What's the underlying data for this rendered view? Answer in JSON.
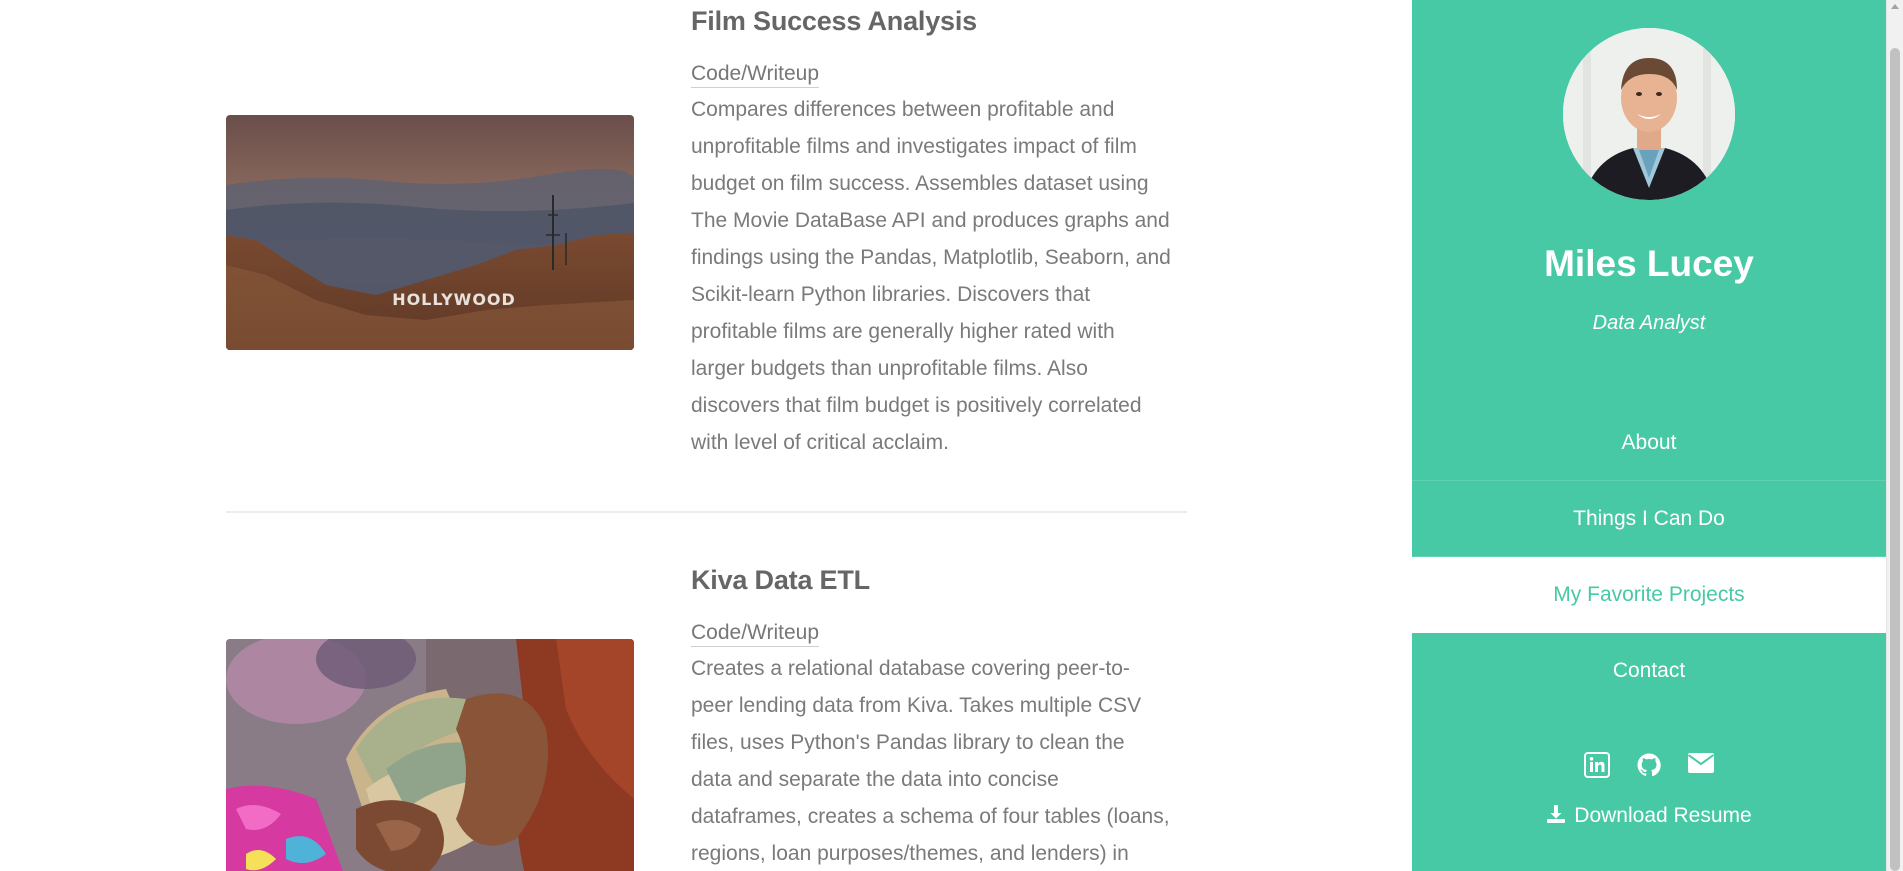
{
  "projects": [
    {
      "title": "Film Success Analysis",
      "link_label": "Code/Writeup",
      "image_name": "hollywood-sign-photo",
      "image_text": "HOLLYWOOD",
      "description": "Compares differences between profitable and unprofitable films and investigates impact of film budget on film success. Assembles dataset using The Movie DataBase API and produces graphs and findings using the Pandas, Matplotlib, Seaborn, and Scikit-learn Python libraries. Discovers that profitable films are generally higher rated with larger budgets than unprofitable films. Also discovers that film budget is positively correlated with level of critical acclaim."
    },
    {
      "title": "Kiva Data ETL",
      "link_label": "Code/Writeup",
      "image_name": "cash-in-hand-photo",
      "description": "Creates a relational database covering peer-to-peer lending data from Kiva. Takes multiple CSV files, uses Python's Pandas library to clean the data and separate the data into concise dataframes, creates a schema of four tables (loans, regions, loan purposes/themes, and lenders) in MySQL, and"
    }
  ],
  "sidebar": {
    "name": "Miles Lucey",
    "role": "Data Analyst",
    "nav": [
      {
        "label": "About",
        "active": false
      },
      {
        "label": "Things I Can Do",
        "active": false
      },
      {
        "label": "My Favorite Projects",
        "active": true
      },
      {
        "label": "Contact",
        "active": false
      }
    ],
    "social_icons": [
      "linkedin-icon",
      "github-icon",
      "envelope-icon"
    ],
    "resume_label": "Download Resume"
  },
  "colors": {
    "accent": "#48c9a5",
    "text": "#777777",
    "title": "#666666"
  }
}
